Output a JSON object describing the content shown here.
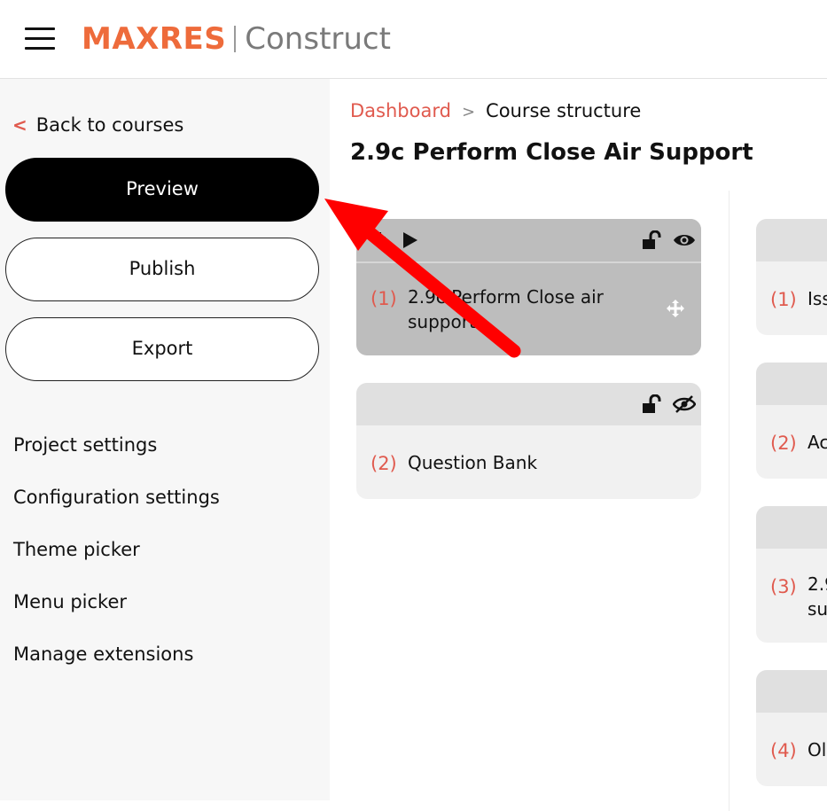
{
  "header": {
    "brand_primary": "MAXRES",
    "brand_secondary": "Construct"
  },
  "sidebar": {
    "back_label": "Back to courses",
    "preview_label": "Preview",
    "publish_label": "Publish",
    "export_label": "Export",
    "nav_items": [
      {
        "label": "Project settings"
      },
      {
        "label": "Configuration settings"
      },
      {
        "label": "Theme picker"
      },
      {
        "label": "Menu picker"
      },
      {
        "label": "Manage extensions"
      }
    ]
  },
  "breadcrumb": {
    "home": "Dashboard",
    "separator": ">",
    "current": "Course structure"
  },
  "page_title": "2.9c Perform Close Air Support",
  "left_column": [
    {
      "number": "(1)",
      "title_line1": "2.9c Perform Close air",
      "title_line2": "support",
      "selected": true
    },
    {
      "number": "(2)",
      "title_line1": "Question Bank",
      "selected": false
    }
  ],
  "right_column": [
    {
      "number": "(1)",
      "title_line1": "Iss"
    },
    {
      "number": "(2)",
      "title_line1": "Ac"
    },
    {
      "number": "(3)",
      "title_line1": "2.9",
      "title_line2": "su"
    },
    {
      "number": "(4)",
      "title_line1": "Ol"
    }
  ],
  "colors": {
    "accent": "#ee6b3b",
    "link": "#e05a4e",
    "annotation_arrow": "#ff0000"
  },
  "icons": [
    "hamburger-icon",
    "chevron-left-icon",
    "add-icon",
    "play-icon",
    "unlock-icon",
    "eye-icon",
    "eye-off-icon",
    "move-icon"
  ]
}
